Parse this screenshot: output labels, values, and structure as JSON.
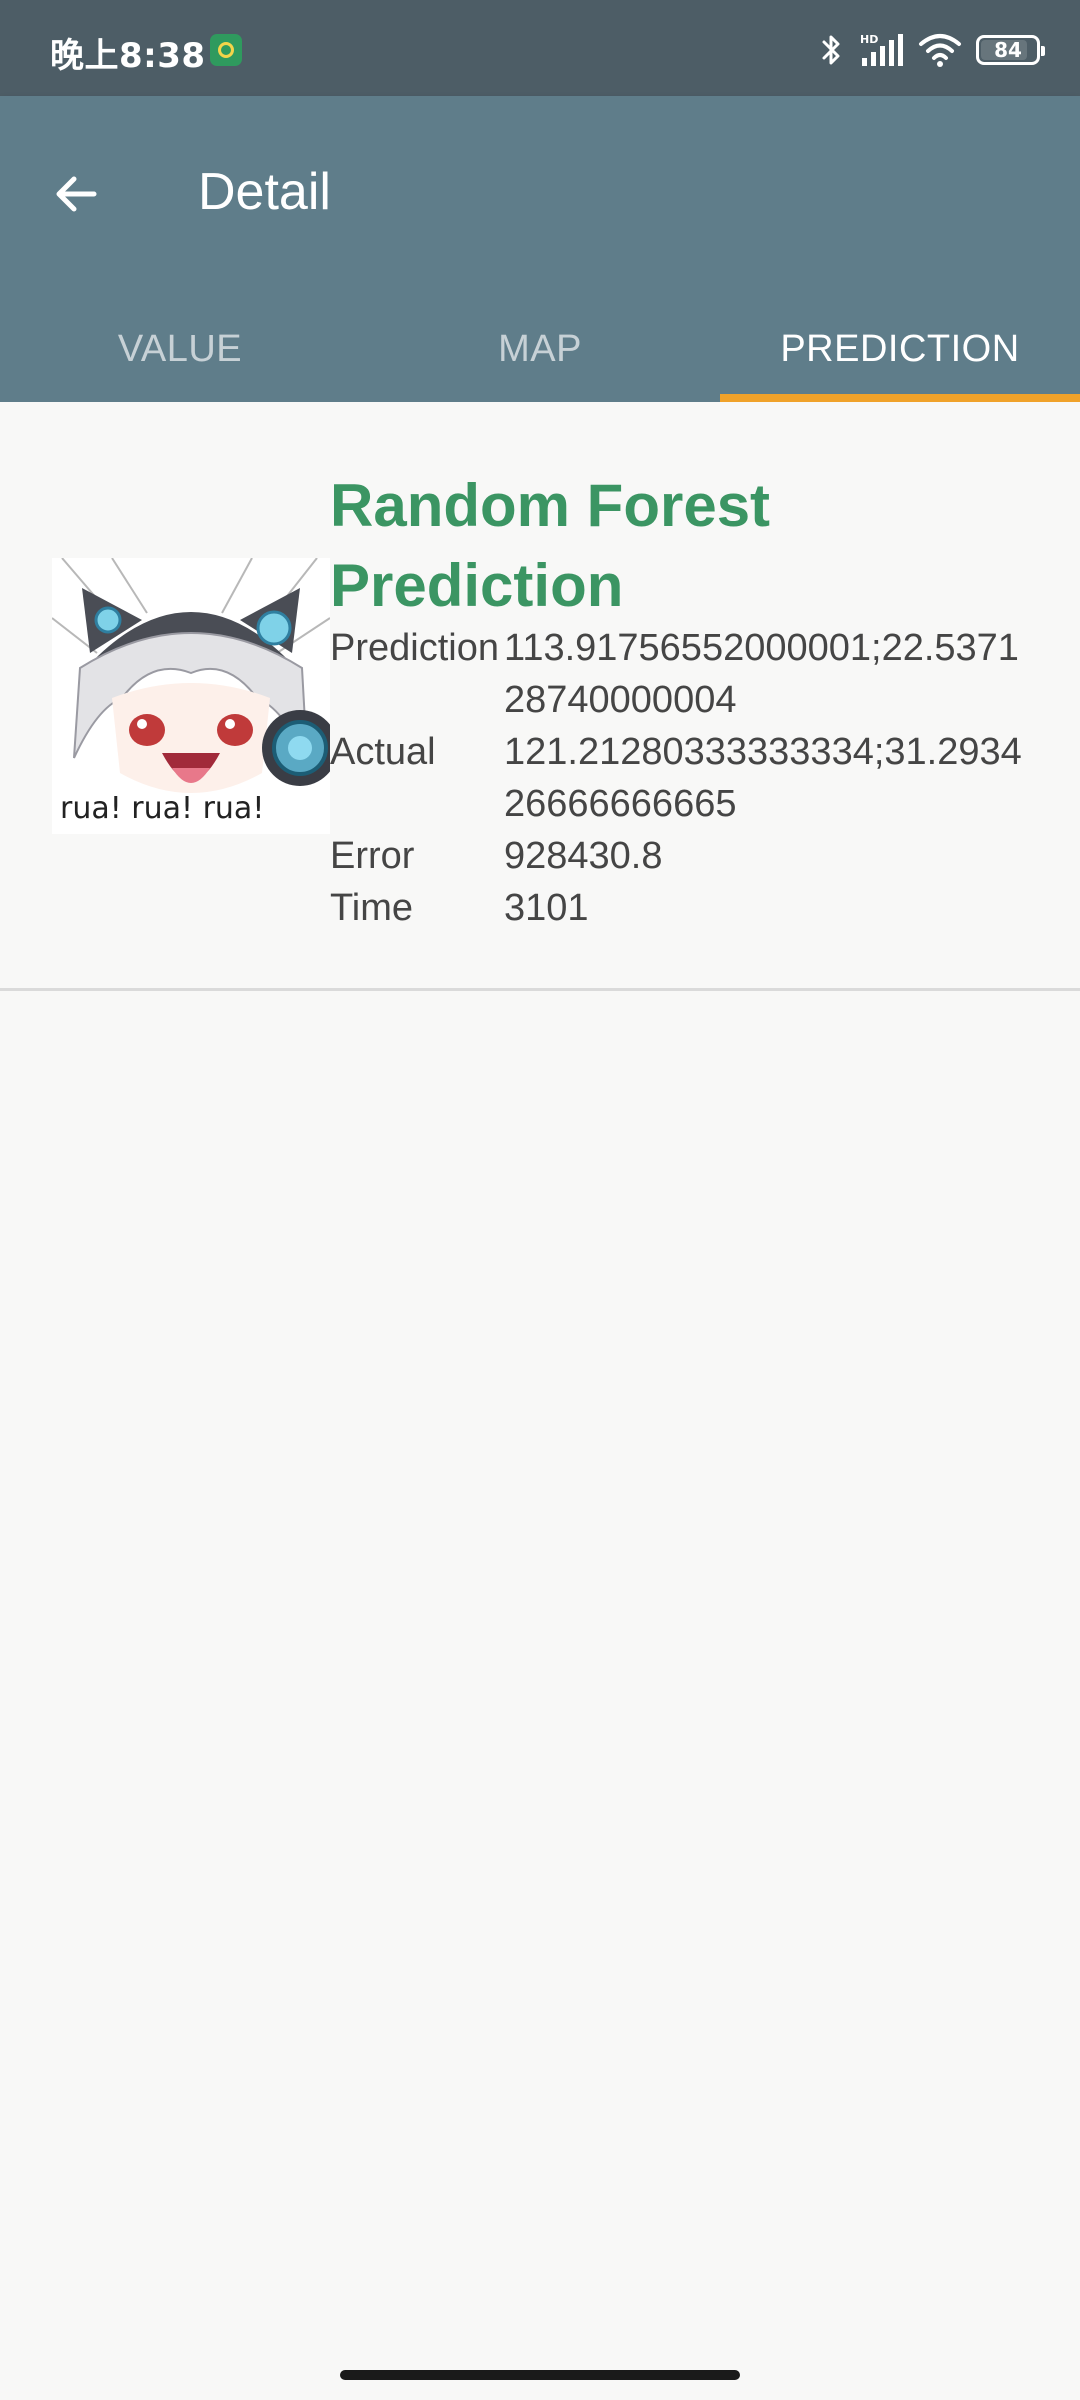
{
  "status_bar": {
    "time": "晚上8:38",
    "battery_level": "84",
    "icons": [
      "app-notification-icon",
      "bluetooth-icon",
      "hd-signal-icon",
      "wifi-icon",
      "battery-icon"
    ]
  },
  "app_bar": {
    "title": "Detail",
    "back_icon": "arrow-left-icon",
    "tabs": [
      {
        "label": "VALUE",
        "active": false
      },
      {
        "label": "MAP",
        "active": false
      },
      {
        "label": "PREDICTION",
        "active": true
      }
    ]
  },
  "prediction_card": {
    "title": "Random Forest Prediction",
    "thumbnail_caption": "rua! rua! rua!",
    "rows": [
      {
        "label": "Prediction",
        "value": "113.91756552000001;22.537128740000004"
      },
      {
        "label": "Actual",
        "value": "121.21280333333334;31.293426666666665"
      },
      {
        "label": "Error",
        "value": "928430.8"
      },
      {
        "label": "Time",
        "value": "3101"
      }
    ]
  },
  "colors": {
    "status_bar": "#4d5d66",
    "app_bar": "#5f7d8a",
    "tab_indicator": "#f0a22a",
    "title_green": "#3b9563",
    "background": "#f8f8f7"
  }
}
